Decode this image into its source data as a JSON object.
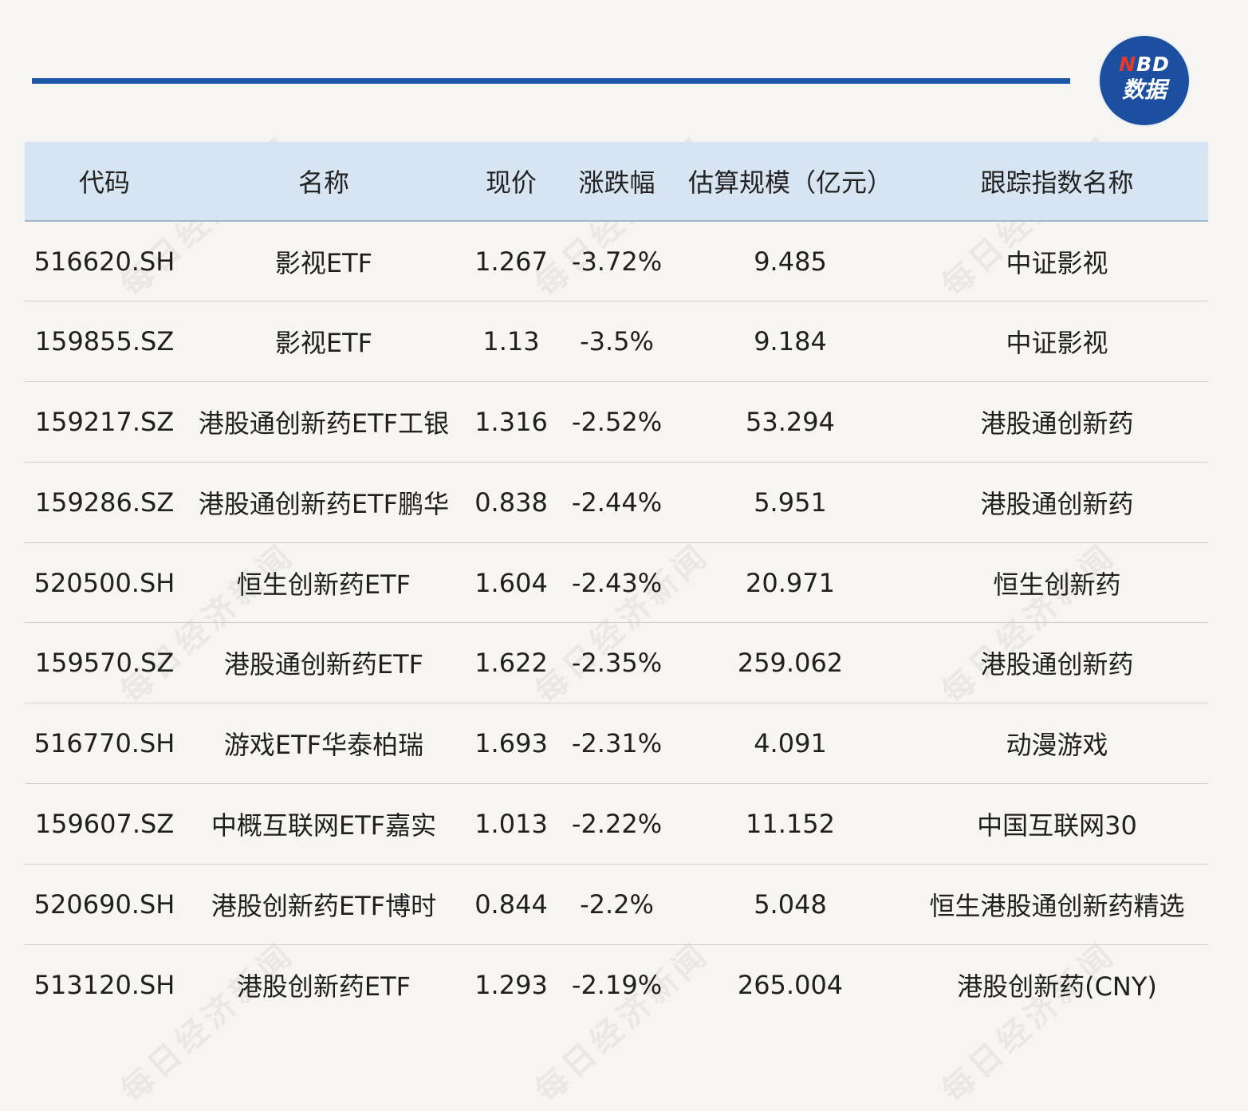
{
  "logo": {
    "n": "N",
    "bd": "BD",
    "line2": "数据"
  },
  "watermark_text": "每日经济新闻",
  "table": {
    "headers": [
      "代码",
      "名称",
      "现价",
      "涨跌幅",
      "估算规模（亿元）",
      "跟踪指数名称"
    ],
    "rows": [
      [
        "516620.SH",
        "影视ETF",
        "1.267",
        "-3.72%",
        "9.485",
        "中证影视"
      ],
      [
        "159855.SZ",
        "影视ETF",
        "1.13",
        "-3.5%",
        "9.184",
        "中证影视"
      ],
      [
        "159217.SZ",
        "港股通创新药ETF工银",
        "1.316",
        "-2.52%",
        "53.294",
        "港股通创新药"
      ],
      [
        "159286.SZ",
        "港股通创新药ETF鹏华",
        "0.838",
        "-2.44%",
        "5.951",
        "港股通创新药"
      ],
      [
        "520500.SH",
        "恒生创新药ETF",
        "1.604",
        "-2.43%",
        "20.971",
        "恒生创新药"
      ],
      [
        "159570.SZ",
        "港股通创新药ETF",
        "1.622",
        "-2.35%",
        "259.062",
        "港股通创新药"
      ],
      [
        "516770.SH",
        "游戏ETF华泰柏瑞",
        "1.693",
        "-2.31%",
        "4.091",
        "动漫游戏"
      ],
      [
        "159607.SZ",
        "中概互联网ETF嘉实",
        "1.013",
        "-2.22%",
        "11.152",
        "中国互联网30"
      ],
      [
        "520690.SH",
        "港股创新药ETF博时",
        "0.844",
        "-2.2%",
        "5.048",
        "恒生港股通创新药精选"
      ],
      [
        "513120.SH",
        "港股创新药ETF",
        "1.293",
        "-2.19%",
        "265.004",
        "港股创新药(CNY)"
      ]
    ]
  }
}
